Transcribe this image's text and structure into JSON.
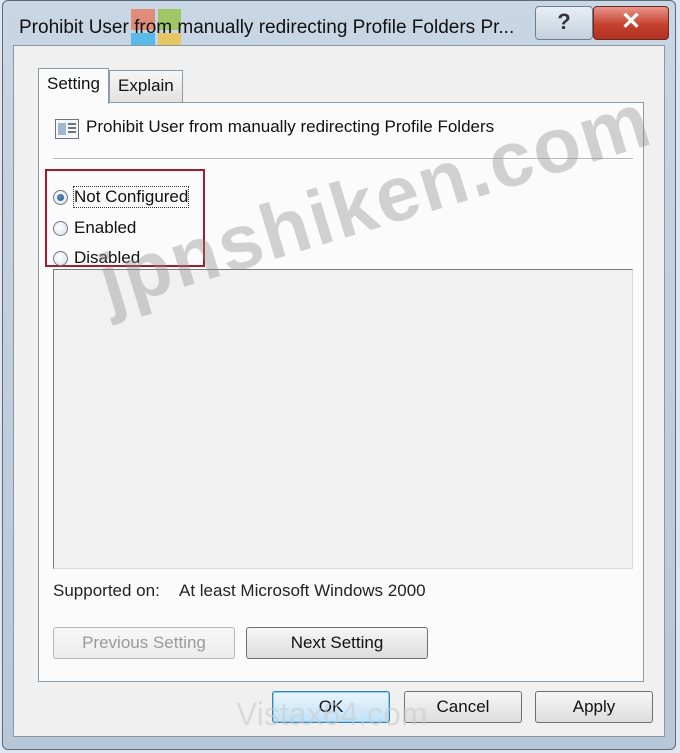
{
  "window": {
    "title": "Prohibit User from manually redirecting Profile Folders Pr...",
    "help_label": "?",
    "close_label": "✕"
  },
  "tabs": [
    {
      "label": "Setting",
      "selected": true
    },
    {
      "label": "Explain",
      "selected": false
    }
  ],
  "policy": {
    "icon": "policy-setting-icon",
    "name": "Prohibit User from manually redirecting Profile Folders"
  },
  "options": [
    {
      "label": "Not Configured",
      "checked": true
    },
    {
      "label": "Enabled",
      "checked": false
    },
    {
      "label": "Disabled",
      "checked": false
    }
  ],
  "supported": {
    "label": "Supported on:",
    "value": "At least Microsoft Windows 2000"
  },
  "nav": {
    "previous_label": "Previous Setting",
    "next_label": "Next Setting"
  },
  "footer": {
    "ok_label": "OK",
    "cancel_label": "Cancel",
    "apply_label": "Apply"
  },
  "watermarks": {
    "main": "jpnshiken.com",
    "bottom": "Vistax64.com"
  },
  "colors": {
    "highlight_box": "#a11d2e",
    "close_button": "#c6412f"
  }
}
